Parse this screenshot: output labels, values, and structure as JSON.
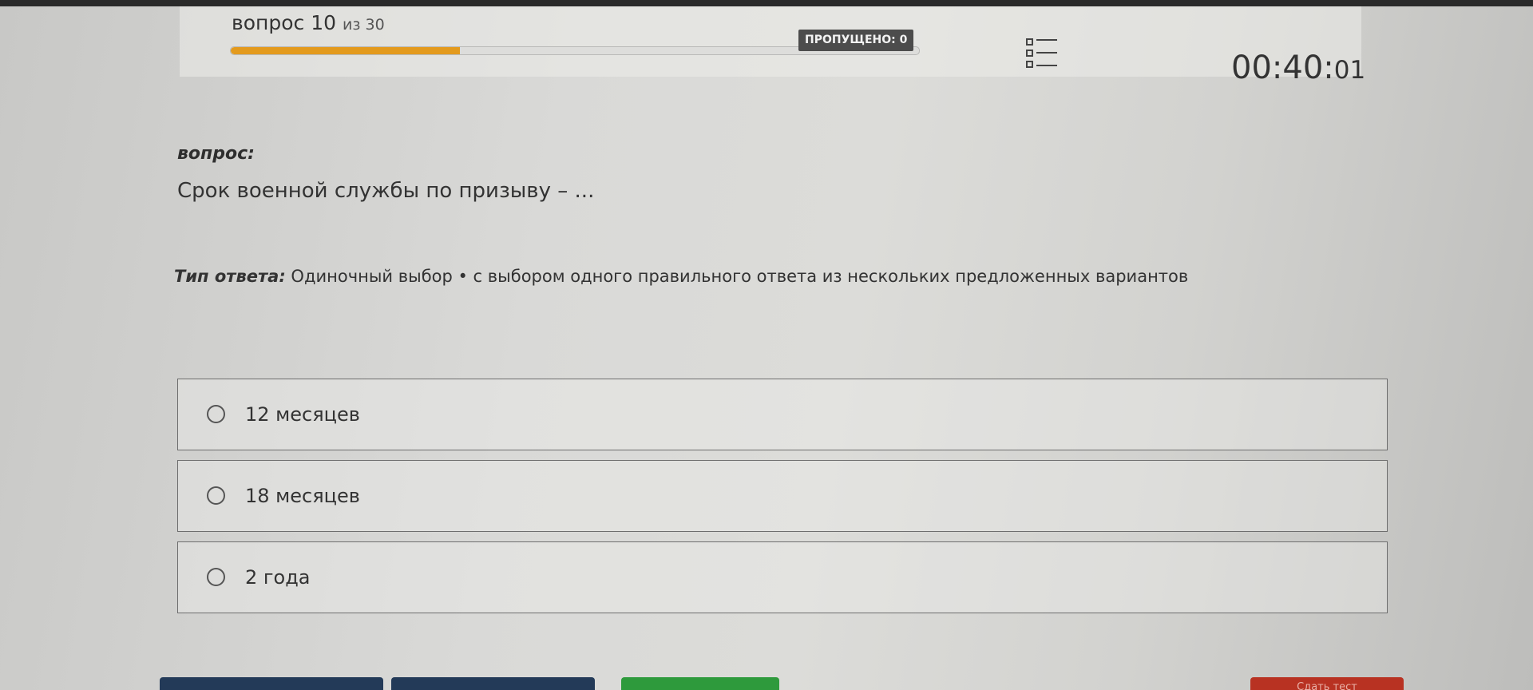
{
  "header": {
    "question_word": "вопрос",
    "question_number": "10",
    "of_total": "из 30",
    "progress_fraction": 0.333,
    "skipped_label": "ПРОПУЩЕНО: 0",
    "timer_main": "00:40:",
    "timer_seconds": "01"
  },
  "question": {
    "label": "вопрос:",
    "text": "Срок военной службы по призыву – ..."
  },
  "answer_type": {
    "label": "Тип ответа:",
    "value": "Одиночный выбор • с выбором одного правильного ответа из нескольких предложенных вариантов"
  },
  "options": [
    {
      "text": "12 месяцев"
    },
    {
      "text": "18 месяцев"
    },
    {
      "text": "2 года"
    }
  ],
  "footer": {
    "submit_label": "Сдать тест"
  },
  "colors": {
    "progress": "#e39a1d",
    "nav_button": "#233a58",
    "green_button": "#2e9a3c",
    "submit_button": "#b83222"
  },
  "icons": [
    "question-list-icon",
    "radio-icon"
  ]
}
